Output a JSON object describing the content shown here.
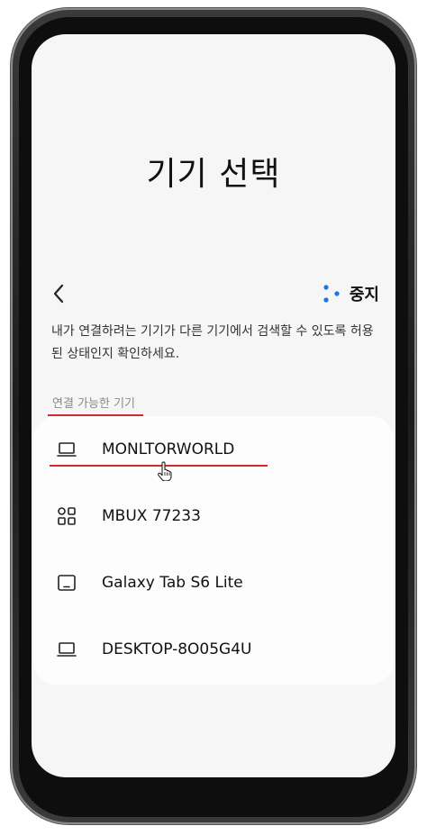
{
  "page": {
    "title": "기기 선택"
  },
  "nav": {
    "back_icon": "chevron-left-icon",
    "stop_label": "중지",
    "loading_icon": "searching-dots-icon",
    "loading_color": "#1a73e8"
  },
  "description": "내가 연결하려는 기기가 다른 기기에서 검색할 수 있도록 허용된 상태인지 확인하세요.",
  "section": {
    "header": "연결 가능한 기기"
  },
  "devices": [
    {
      "name": "MONLTORWORLD",
      "icon": "laptop-icon"
    },
    {
      "name": "MBUX 77233",
      "icon": "apps-grid-icon"
    },
    {
      "name": "Galaxy Tab S6 Lite",
      "icon": "tablet-icon"
    },
    {
      "name": "DESKTOP-8O05G4U",
      "icon": "laptop-icon"
    }
  ],
  "annotation_color": "#d02a2a"
}
